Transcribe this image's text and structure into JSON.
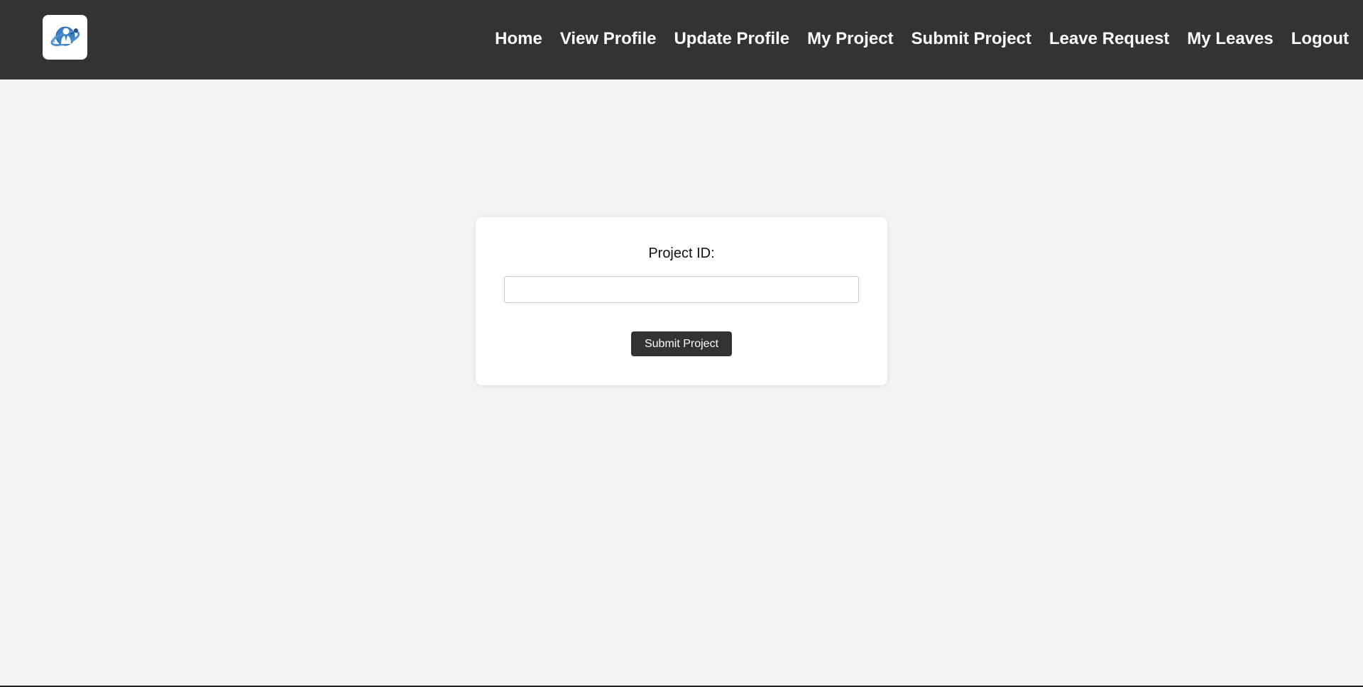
{
  "nav": {
    "logo_icon": "employee-globe-logo-icon",
    "items": [
      {
        "label": "Home"
      },
      {
        "label": "View Profile"
      },
      {
        "label": "Update Profile"
      },
      {
        "label": "My Project"
      },
      {
        "label": "Submit Project"
      },
      {
        "label": "Leave Request"
      },
      {
        "label": "My Leaves"
      },
      {
        "label": "Logout"
      }
    ]
  },
  "form": {
    "project_id_label": "Project ID:",
    "project_id_value": "",
    "project_id_placeholder": "",
    "submit_label": "Submit Project"
  },
  "colors": {
    "navbar_bg": "#333333",
    "page_bg": "#f3f3f3",
    "button_bg": "#333333",
    "logo_blue": "#3b7fc4"
  }
}
